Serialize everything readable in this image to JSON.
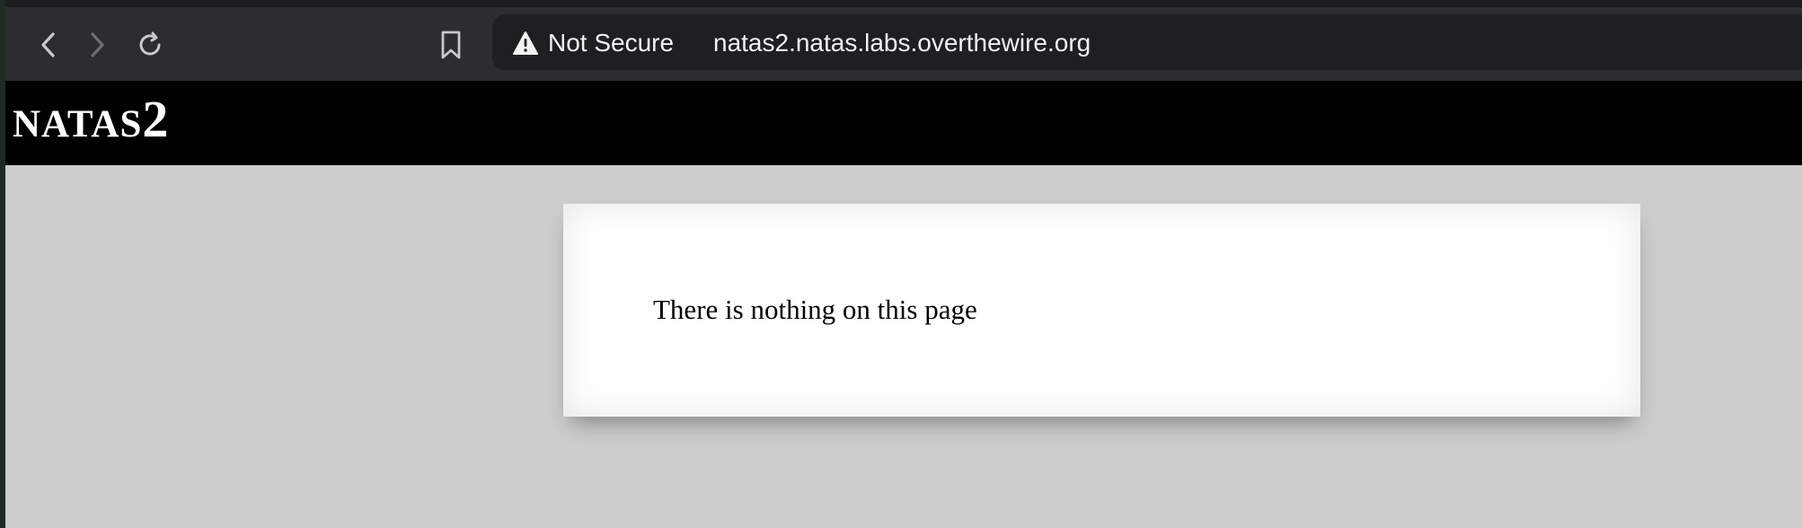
{
  "browser": {
    "security_label": "Not Secure",
    "url": "natas2.natas.labs.overthewire.org",
    "icons": {
      "back": "chevron-left-icon",
      "forward": "chevron-right-icon",
      "reload": "reload-icon",
      "bookmark": "bookmark-icon",
      "warning": "warning-triangle-icon"
    }
  },
  "header": {
    "title_caps": "NATAS",
    "title_number": "2"
  },
  "content": {
    "message": "There is nothing on this page"
  },
  "colors": {
    "toolbar": "#2b2d30",
    "address_bar": "#1e1f22",
    "header_bg": "#000000",
    "page_bg": "#cccccc",
    "card_bg": "#ffffff"
  }
}
